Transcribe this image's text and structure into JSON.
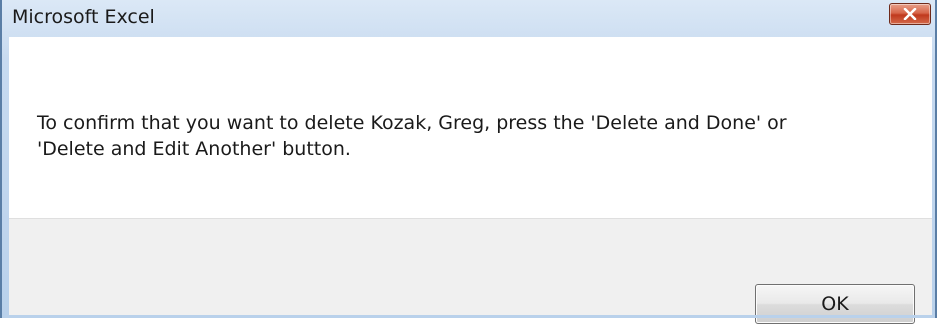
{
  "window": {
    "title": "Microsoft Excel"
  },
  "titlebar": {
    "close_icon": "close-icon"
  },
  "message": {
    "line1": "To confirm that you want to delete Kozak, Greg, press the 'Delete and Done' or",
    "line2": "'Delete and Edit Another' button."
  },
  "buttons": {
    "ok_label": "OK"
  },
  "colors": {
    "frame_border": "#5a7ea6",
    "titlebar_bg": "#c7daf0",
    "close_button": "#c0391d",
    "footer_bg": "#f0f0f0"
  }
}
